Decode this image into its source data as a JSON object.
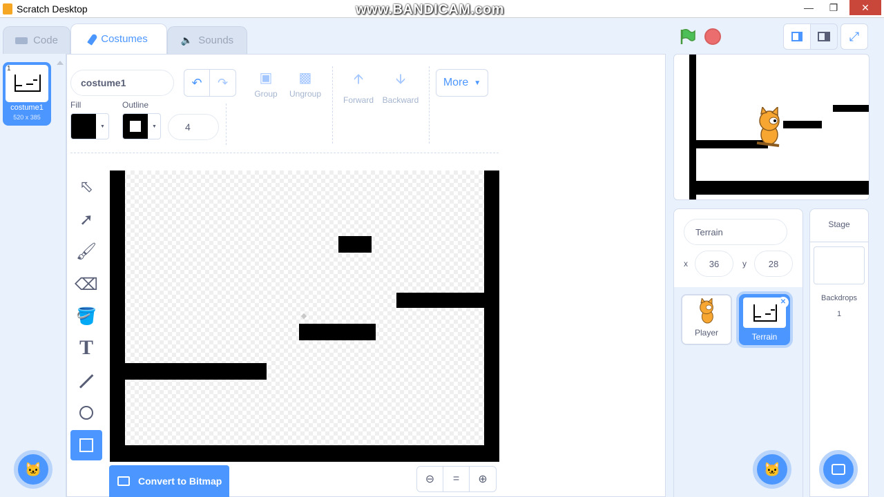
{
  "window": {
    "title": "Scratch Desktop",
    "watermark": "www.BANDICAM.com"
  },
  "tabs": [
    {
      "label": "Code",
      "icon": "code-blocks-icon"
    },
    {
      "label": "Costumes",
      "icon": "brush-icon"
    },
    {
      "label": "Sounds",
      "icon": "speaker-icon"
    }
  ],
  "costumes": [
    {
      "index": "1",
      "name": "costume1",
      "size": "520 x 385"
    }
  ],
  "paint_editor": {
    "costume_name": "costume1",
    "buttons": {
      "group": "Group",
      "ungroup": "Ungroup",
      "forward": "Forward",
      "backward": "Backward",
      "more": "More"
    },
    "fill_label": "Fill",
    "outline_label": "Outline",
    "outline_width": "4",
    "fill_color": "#000000",
    "outline_color": "#000000",
    "convert_button": "Convert to Bitmap",
    "zoom": {
      "out": "zoom-out-icon",
      "reset": "=",
      "in": "zoom-in-icon"
    }
  },
  "sprite_info": {
    "name": "Terrain",
    "x_label": "x",
    "x": "36",
    "y_label": "y",
    "y": "28"
  },
  "sprites": [
    {
      "name": "Player"
    },
    {
      "name": "Terrain"
    }
  ],
  "stage_panel": {
    "title": "Stage",
    "backdrops_label": "Backdrops",
    "backdrops_count": "1"
  },
  "colors": {
    "accent": "#4c97ff",
    "stop": "#ec6d6d",
    "flag": "#4cbf56"
  }
}
